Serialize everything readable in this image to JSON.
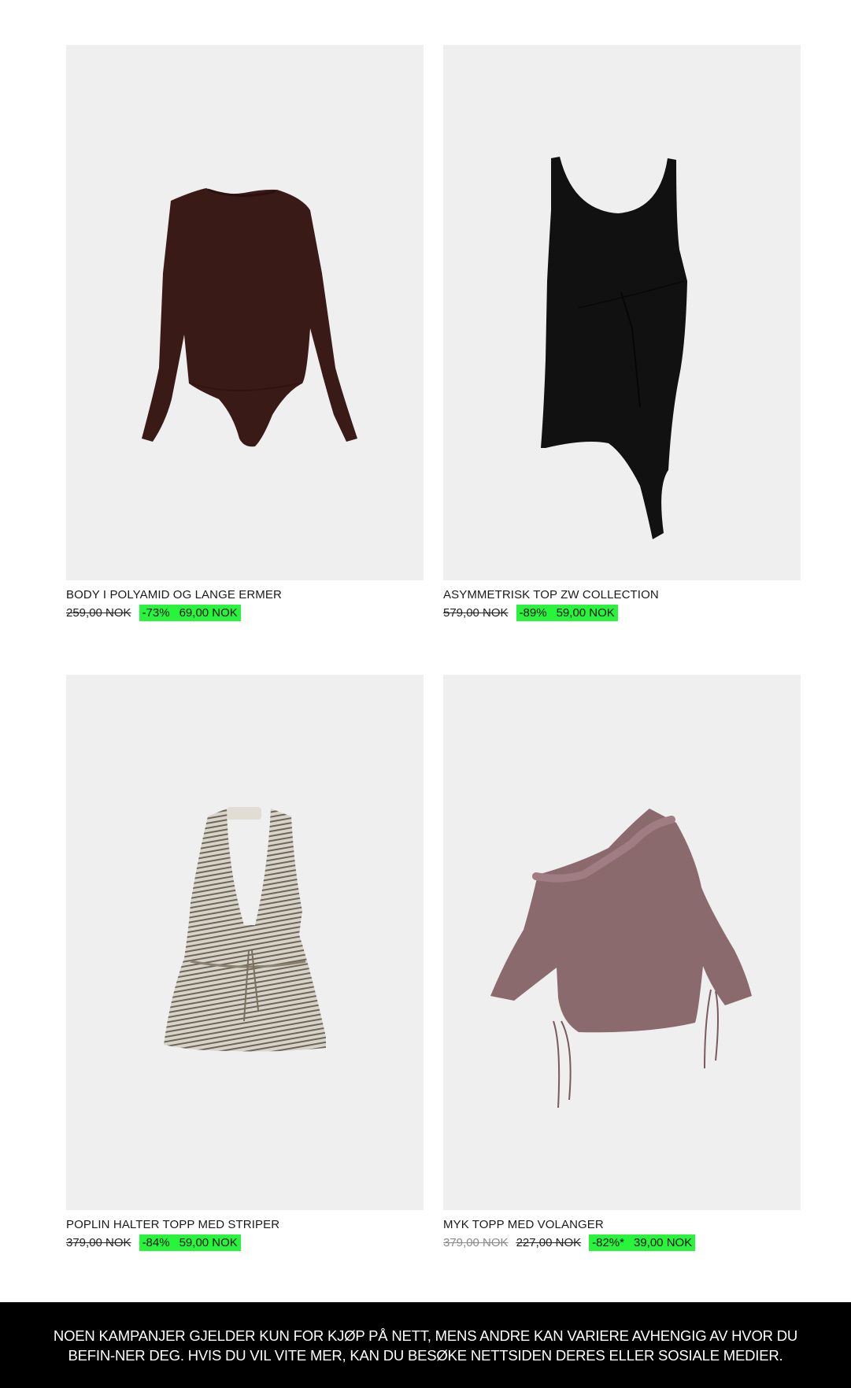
{
  "products": [
    {
      "name": "BODY I POLYAMID OG LANGE ERMER",
      "old_price": "259,00 NOK",
      "discount": "-73%",
      "sale_price": "69,00 NOK",
      "garment_color": "#3a1a17"
    },
    {
      "name": "ASYMMETRISK TOP ZW COLLECTION",
      "old_price": "579,00 NOK",
      "discount": "-89%",
      "sale_price": "59,00 NOK",
      "garment_color": "#111111"
    },
    {
      "name": "POPLIN HALTER TOPP MED STRIPER",
      "old_price": "379,00 NOK",
      "discount": "-84%",
      "sale_price": "59,00 NOK",
      "garment_color": "#b8b2a6"
    },
    {
      "name": "MYK TOPP MED VOLANGER",
      "old_price": "379,00 NOK",
      "mid_price": "227,00 NOK",
      "discount": "-82%*",
      "sale_price": "39,00 NOK",
      "garment_color": "#8b6a6e"
    }
  ],
  "footer": {
    "text": "NOEN KAMPANJER GJELDER KUN FOR KJØP PÅ NETT, MENS ANDRE KAN VARIERE AVHENGIG AV HVOR DU BEFIN-NER DEG. HVIS DU VIL VITE MER, KAN DU BESØKE NETTSIDEN DERES ELLER SOSIALE MEDIER."
  },
  "colors": {
    "sale_highlight": "#27f43a",
    "image_bg": "#efefef",
    "footer_bg": "#000000"
  }
}
